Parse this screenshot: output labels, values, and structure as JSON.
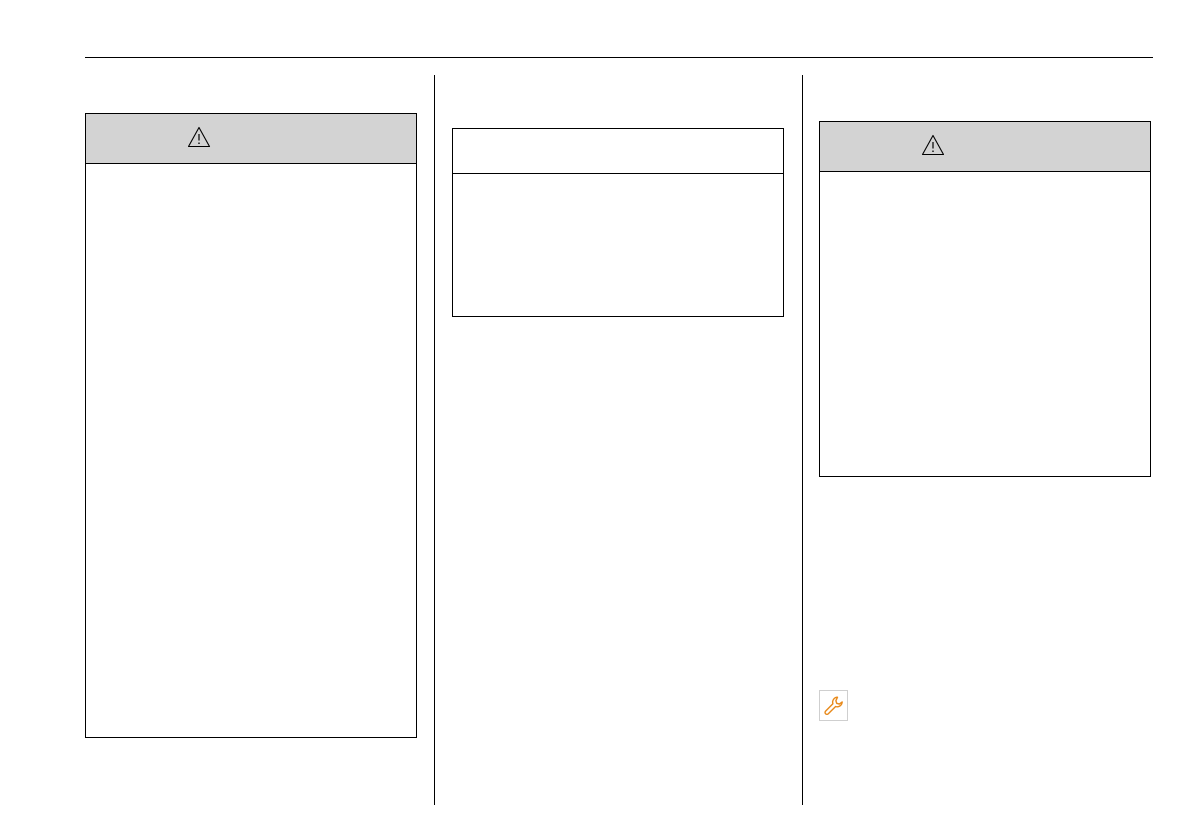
{
  "icons": {
    "warning": "warning-triangle-icon",
    "service": "wrench-icon"
  },
  "colors": {
    "warning_header_fill": "#d3d3d3",
    "rule": "#000000",
    "service_icon": "#e8891a"
  }
}
